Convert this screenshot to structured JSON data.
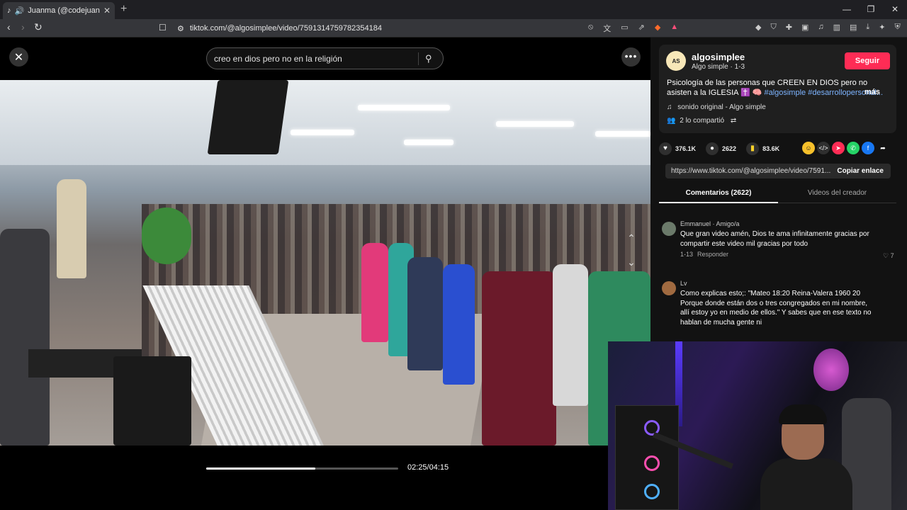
{
  "browser": {
    "tab_title": "Juanma (@codejuanma) | TikTok",
    "url": "tiktok.com/@algosimplee/video/7591314759782354184",
    "colors": {
      "tabbar": "#1f1f23",
      "toolbar": "#35363a"
    }
  },
  "player": {
    "search_text": "creo en dios pero no en la religión",
    "time": "02:25/04:15",
    "progress": 0.57
  },
  "creator": {
    "avatar_text": "AS",
    "username": "algosimplee",
    "subtitle": "Algo simple · 1-3",
    "follow_label": "Seguir",
    "description": "Psicología de las personas que CREEN EN DIOS pero no asisten a la IGLESIA ✝️ 🧠 ",
    "tags": "#algosimple #desarrollopersonal...",
    "more_label": "más",
    "sound": "sonido original - Algo simple",
    "shared": "2 lo compartió"
  },
  "stats": {
    "likes": "376.1K",
    "comments": "2622",
    "saves": "83.6K"
  },
  "link": {
    "url": "https://www.tiktok.com/@algosimplee/video/7591...",
    "copy_label": "Copiar enlace"
  },
  "tabs": {
    "comments": "Comentarios (2622)",
    "creator_videos": "Videos del creador"
  },
  "comments": [
    {
      "author": "Emmanuel · Amigo/a",
      "text": "Que gran video amén, Dios te ama infinitamente gracias por compartir este video mil gracias por todo",
      "date": "1-13",
      "reply": "Responder",
      "likes": "7"
    },
    {
      "author": "Lv",
      "text": "Como explicas esto;: \"Mateo 18:20 Reina-Valera 1960 20 Porque donde están dos o tres congregados en mi nombre, allí estoy yo en medio de ellos.\" Y sabes que en ese texto no hablan de mucha gente ni"
    }
  ]
}
